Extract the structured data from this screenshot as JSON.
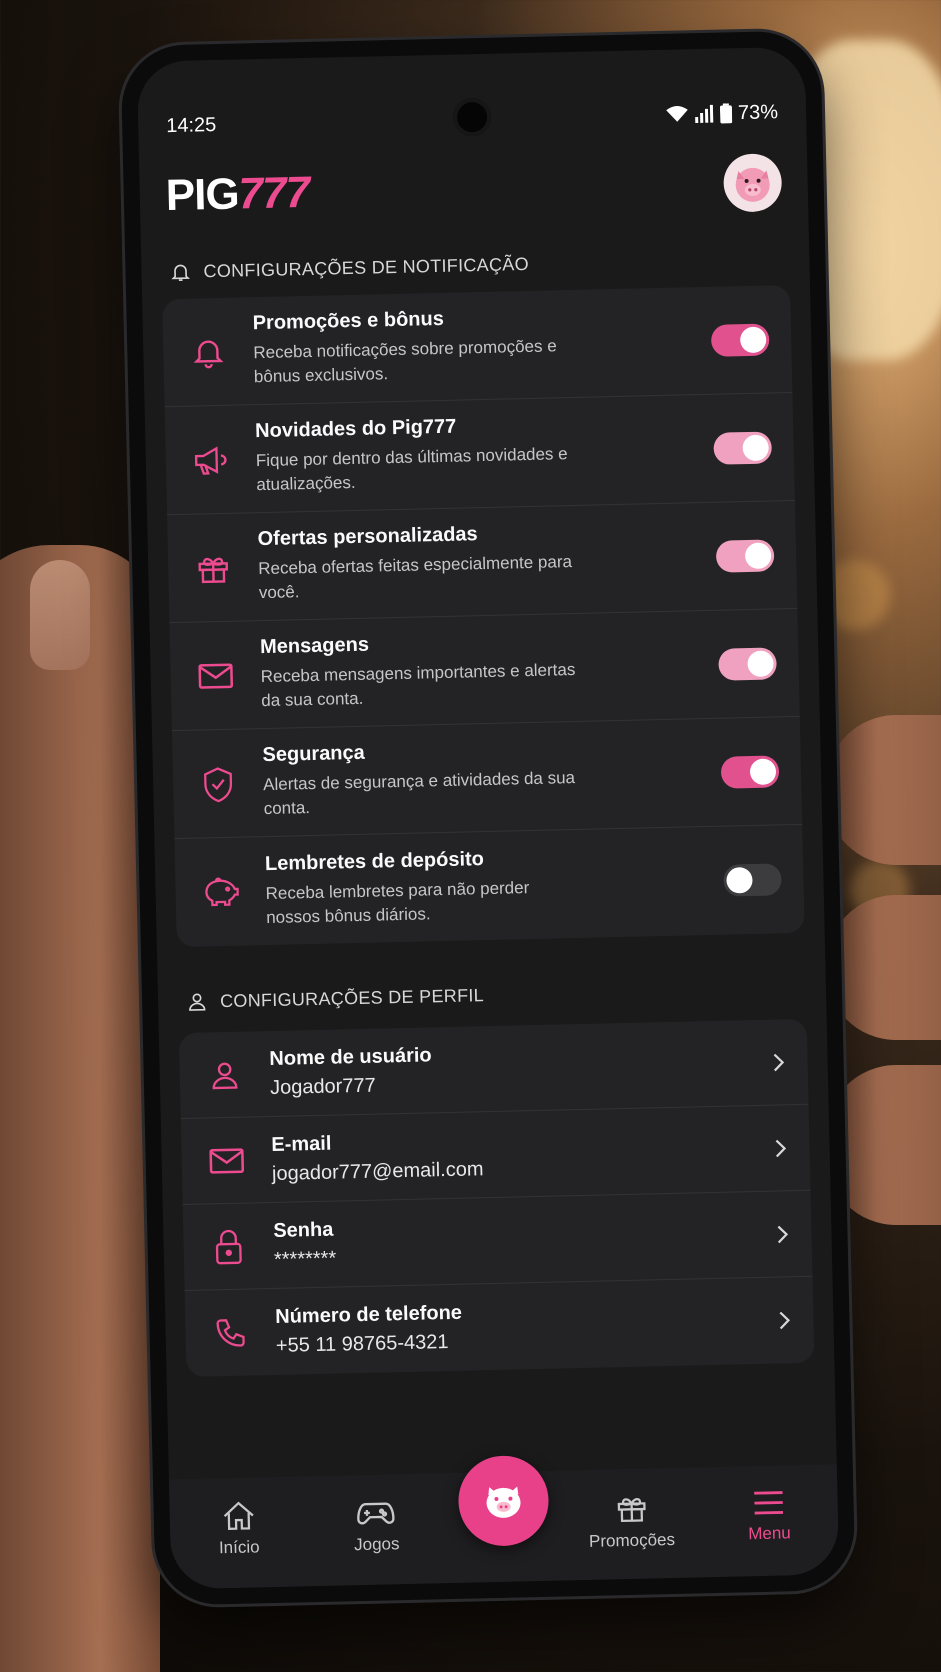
{
  "status_bar": {
    "time": "14:25",
    "battery": "73%"
  },
  "header": {
    "logo_part1": "PIG",
    "logo_part2": "777"
  },
  "notifications": {
    "section_title": "CONFIGURAÇÕES DE NOTIFICAÇÃO",
    "items": [
      {
        "title": "Promoções e bônus",
        "desc": "Receba notificações sobre promoções e bônus exclusivos.",
        "icon": "bell-icon",
        "enabled": true
      },
      {
        "title": "Novidades do Pig777",
        "desc": "Fique por dentro das últimas novidades e atualizações.",
        "icon": "megaphone-icon",
        "enabled": true
      },
      {
        "title": "Ofertas personalizadas",
        "desc": "Receba ofertas feitas especialmente para você.",
        "icon": "gift-icon",
        "enabled": true
      },
      {
        "title": "Mensagens",
        "desc": "Receba mensagens importantes e alertas da sua conta.",
        "icon": "mail-icon",
        "enabled": true
      },
      {
        "title": "Segurança",
        "desc": "Alertas de segurança e atividades da sua conta.",
        "icon": "shield-icon",
        "enabled": true
      },
      {
        "title": "Lembretes de depósito",
        "desc": "Receba lembretes para não perder nossos bônus diários.",
        "icon": "piggy-bank-icon",
        "enabled": false
      }
    ]
  },
  "profile": {
    "section_title": "CONFIGURAÇÕES DE PERFIL",
    "items": [
      {
        "title": "Nome de usuário",
        "value": "Jogador777",
        "icon": "user-icon"
      },
      {
        "title": "E-mail",
        "value": "jogador777@email.com",
        "icon": "mail-icon"
      },
      {
        "title": "Senha",
        "value": "********",
        "icon": "lock-icon"
      },
      {
        "title": "Número de telefone",
        "value": "+55 11 98765-4321",
        "icon": "phone-icon"
      }
    ]
  },
  "bottom_nav": {
    "items": [
      {
        "label": "Início",
        "icon": "home-icon"
      },
      {
        "label": "Jogos",
        "icon": "gamepad-icon"
      },
      {
        "label": "Promoções",
        "icon": "gift-icon"
      },
      {
        "label": "Menu",
        "icon": "menu-icon"
      }
    ],
    "center_icon": "piggy-icon",
    "active": "Menu"
  },
  "colors": {
    "accent": "#e8418a",
    "accent_light": "#f0a1c0",
    "background": "#1a1a1b",
    "card": "#232325"
  }
}
